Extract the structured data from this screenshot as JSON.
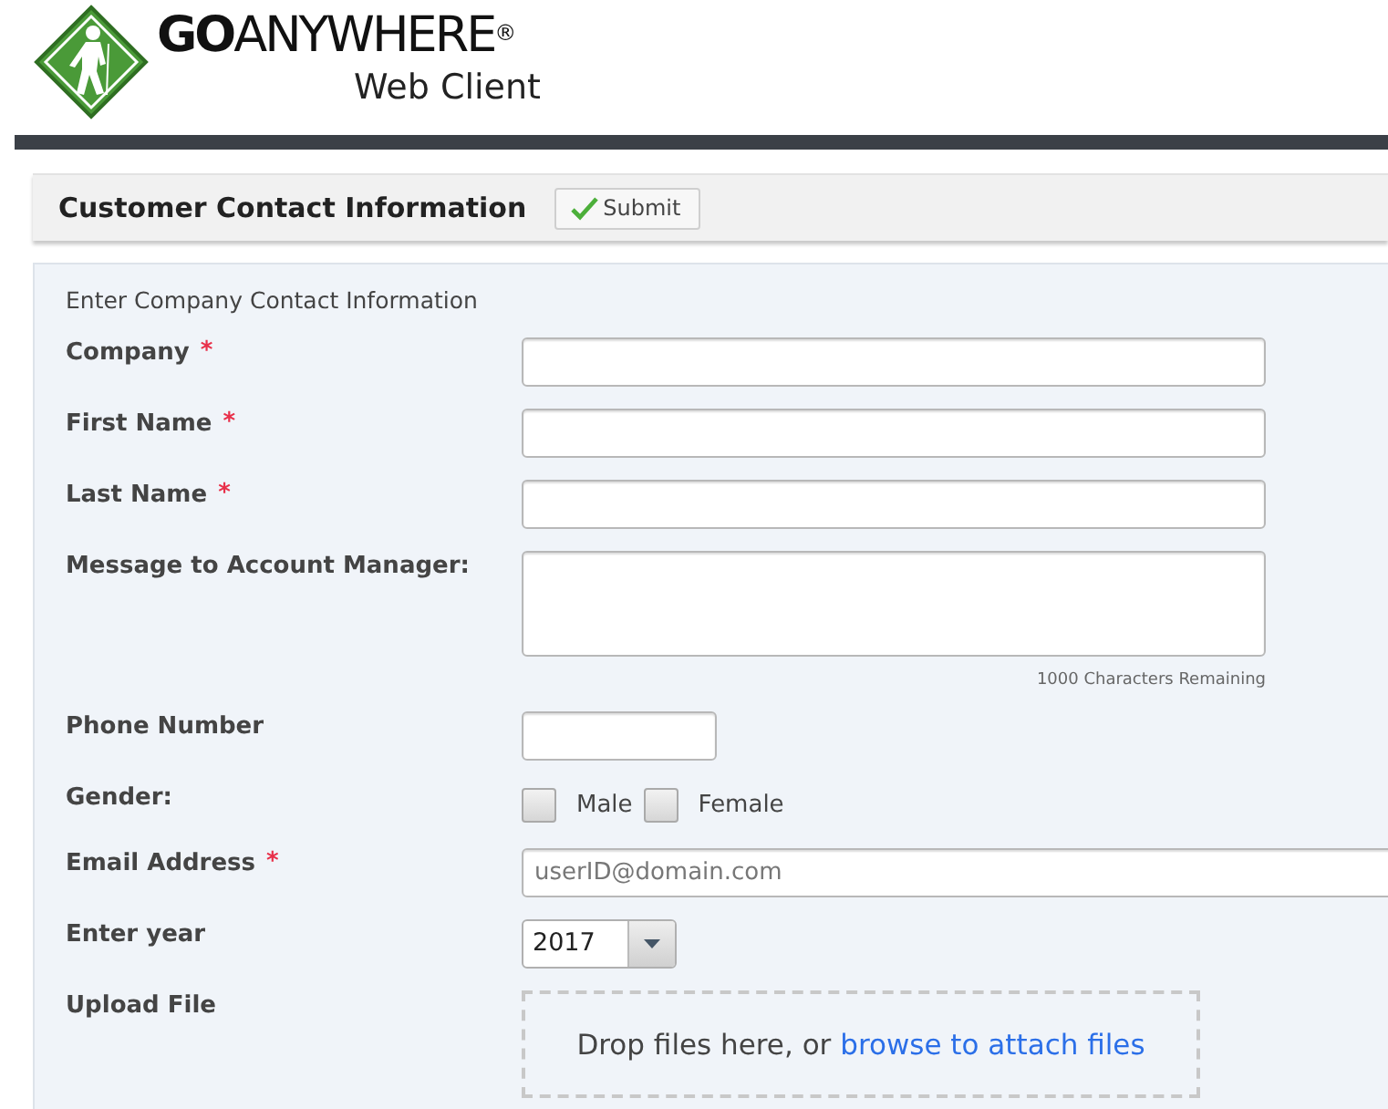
{
  "logo": {
    "brand": "**GO**ANYWHERE$^{®}$",
    "subtitle": "Web Client"
  },
  "header": {
    "title": "Customer Contact Information",
    "submit": "Submit"
  },
  "form": {
    "intro": "Enter Company Contact Information",
    "rows": [
      {
        "kind": "text",
        "label": "Company",
        "required_mark": "*"
      },
      {
        "kind": "text",
        "label": "First Name",
        "required_mark": "*"
      },
      {
        "kind": "text",
        "label": "Last Name",
        "required_mark": "*"
      },
      {
        "kind": "textarea",
        "label": "Message to Account Manager:",
        "counter": "1000 Characters Remaining"
      },
      {
        "kind": "short",
        "label": "Phone Number"
      },
      {
        "kind": "checkboxes",
        "label": "Gender:",
        "options": [
          {
            "label": "Male",
            "checked": false
          },
          {
            "label": "Female",
            "checked": false
          }
        ]
      },
      {
        "kind": "wide",
        "label": "Email Address",
        "required_mark": "*",
        "placeholder": "userID@domain.com"
      },
      {
        "kind": "select",
        "label": "Enter year",
        "value": "2017"
      },
      {
        "kind": "upload",
        "label": "Upload File",
        "text": "Drop files here, or ",
        "link": "browse to attach files"
      }
    ]
  }
}
